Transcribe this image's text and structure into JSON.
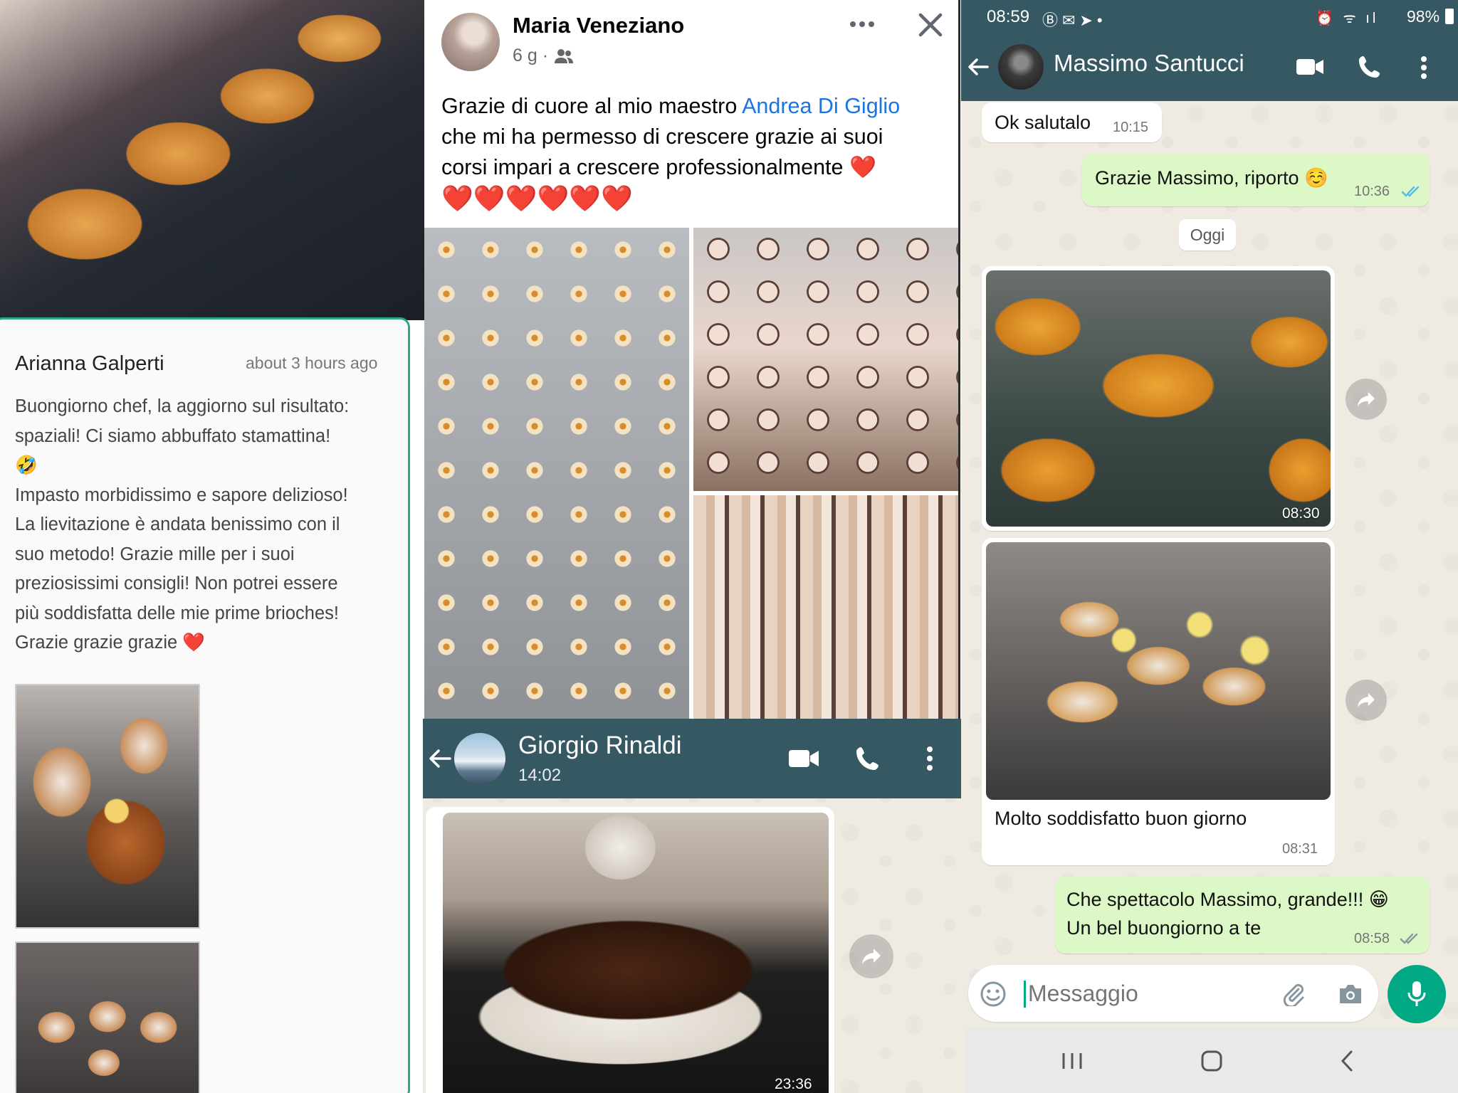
{
  "panel_left": {
    "comment": {
      "author": "Arianna Galperti",
      "time": "about 3 hours ago",
      "lines": [
        "Buongiorno chef, la aggiorno sul risultato:",
        "spaziali! Ci siamo abbuffato stamattina!",
        "🤣",
        "Impasto morbidissimo e sapore delizioso!",
        "La lievitazione è andata benissimo con il",
        "suo metodo! Grazie mille per i suoi",
        "preziosissimi consigli! Non potrei essere",
        "più soddisfatta delle mie prime brioches!",
        "Grazie grazie grazie ❤️"
      ]
    }
  },
  "panel_middle": {
    "post": {
      "author": "Maria Veneziano",
      "meta": "6 g ·",
      "text_before_link": "Grazie di cuore al mio maestro ",
      "link": "Andrea Di Giglio",
      "text_lines": [
        "che mi ha permesso di crescere grazie ai suoi",
        "corsi impari a crescere professionalmente ❤️"
      ],
      "hearts": "❤️❤️❤️❤️❤️❤️"
    },
    "chat": {
      "contact": "Giorgio Rinaldi",
      "status": "14:02",
      "image_time": "23:36"
    }
  },
  "panel_right": {
    "status_bar": {
      "time": "08:59",
      "battery": "98%"
    },
    "chat": {
      "contact": "Massimo Santucci",
      "messages": [
        {
          "dir": "in",
          "text": "Ok salutalo",
          "time": "10:15"
        },
        {
          "dir": "out",
          "text": "Grazie Massimo, riporto ☺️",
          "time": "10:36"
        },
        {
          "dir": "date",
          "text": "Oggi"
        },
        {
          "dir": "in",
          "image": true,
          "time": "08:30"
        },
        {
          "dir": "in",
          "image": true,
          "caption": "Molto soddisfatto buon giorno",
          "time": "08:31"
        },
        {
          "dir": "out",
          "lines": [
            "Che spettacolo Massimo, grande!!! 😁",
            "Un bel buongiorno a te"
          ],
          "time": "08:58"
        }
      ],
      "input_placeholder": "Messaggio"
    }
  },
  "colors": {
    "wa_header": "#355863",
    "wa_outgoing": "#dcf8c6",
    "wa_mic": "#00a884",
    "fb_link": "#1b74e4",
    "card_border": "#2aa88a"
  }
}
